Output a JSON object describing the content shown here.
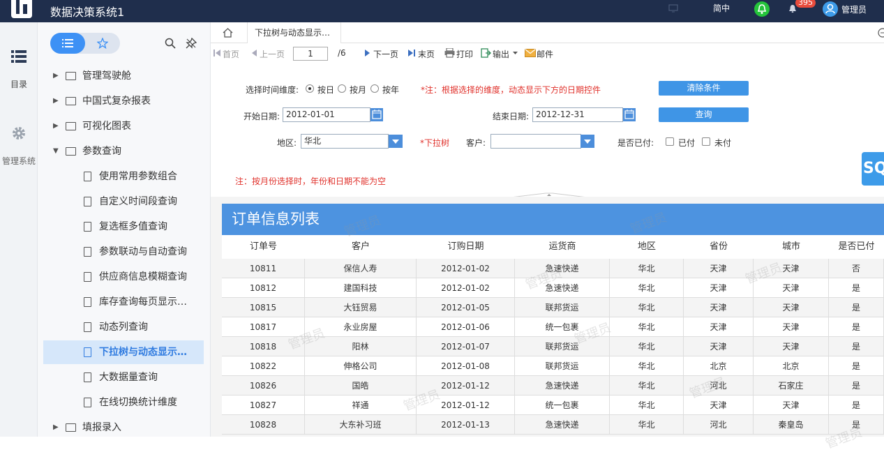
{
  "app": {
    "title": "数据决策系统1",
    "lang": "简中",
    "notif_count": "395",
    "user": "管理员"
  },
  "rail": {
    "catalog": "目录",
    "admin": "管理系统"
  },
  "tree": [
    {
      "label": "管理驾驶舱",
      "type": "folder"
    },
    {
      "label": "中国式复杂报表",
      "type": "folder"
    },
    {
      "label": "可视化图表",
      "type": "folder"
    },
    {
      "label": "参数查询",
      "type": "folder",
      "expanded": true
    },
    {
      "label": "使用常用参数组合",
      "type": "doc"
    },
    {
      "label": "自定义时间段查询",
      "type": "doc"
    },
    {
      "label": "复选框多值查询",
      "type": "doc"
    },
    {
      "label": "参数联动与自动查询",
      "type": "doc"
    },
    {
      "label": "供应商信息模糊查询",
      "type": "doc"
    },
    {
      "label": "库存查询每页显示…",
      "type": "doc"
    },
    {
      "label": "动态列查询",
      "type": "doc"
    },
    {
      "label": "下拉树与动态显示…",
      "type": "doc",
      "active": true
    },
    {
      "label": "大数据量查询",
      "type": "doc"
    },
    {
      "label": "在线切换统计维度",
      "type": "doc"
    },
    {
      "label": "填报录入",
      "type": "folder"
    }
  ],
  "tab": {
    "label": "下拉树与动态显示…"
  },
  "toolbar": {
    "first": "首页",
    "prev": "上一页",
    "page": "1",
    "total": "/6",
    "next": "下一页",
    "last": "末页",
    "print": "打印",
    "export": "输出",
    "mail": "邮件"
  },
  "form": {
    "dim_label": "选择时间维度:",
    "by_day": "按日",
    "by_month": "按月",
    "by_year": "按年",
    "note1": "*注：根据选择的维度，动态显示下方的日期控件",
    "clear_btn": "清除条件",
    "start_label": "开始日期:",
    "start_value": "2012-01-01",
    "end_label": "结束日期:",
    "end_value": "2012-12-31",
    "query_btn": "查询",
    "region_label": "地区:",
    "region_value": "华北",
    "tree_note": "*下拉树",
    "customer_label": "客户:",
    "customer_value": "",
    "paid_label": "是否已付:",
    "paid": "已付",
    "unpaid": "未付",
    "note2": "注：按月份选择时，年份和日期不能为空"
  },
  "sq_label": "SQ",
  "report": {
    "title": "订单信息列表",
    "watermark": "管理员",
    "columns": [
      "订单号",
      "客户",
      "订购日期",
      "运货商",
      "地区",
      "省份",
      "城市",
      "是否已付"
    ],
    "rows": [
      [
        "10811",
        "保信人寿",
        "2012-01-02",
        "急速快递",
        "华北",
        "天津",
        "天津",
        "否"
      ],
      [
        "10812",
        "建国科技",
        "2012-01-02",
        "急速快递",
        "华北",
        "天津",
        "天津",
        "是"
      ],
      [
        "10815",
        "大钰贸易",
        "2012-01-05",
        "联邦货运",
        "华北",
        "天津",
        "天津",
        "是"
      ],
      [
        "10817",
        "永业房屋",
        "2012-01-06",
        "统一包裹",
        "华北",
        "天津",
        "天津",
        "是"
      ],
      [
        "10818",
        "阳林",
        "2012-01-07",
        "联邦货运",
        "华北",
        "天津",
        "天津",
        "是"
      ],
      [
        "10822",
        "伸格公司",
        "2012-01-08",
        "联邦货运",
        "华北",
        "北京",
        "北京",
        "是"
      ],
      [
        "10826",
        "国皓",
        "2012-01-12",
        "急速快递",
        "华北",
        "河北",
        "石家庄",
        "是"
      ],
      [
        "10827",
        "祥通",
        "2012-01-12",
        "统一包裹",
        "华北",
        "天津",
        "天津",
        "是"
      ],
      [
        "10828",
        "大东补习班",
        "2012-01-13",
        "急速快递",
        "华北",
        "河北",
        "秦皇岛",
        "是"
      ]
    ]
  },
  "colors": {
    "topbar": "#1f2e4c",
    "accent": "#3d91f5",
    "header": "#4d93e0",
    "note": "#e0312b"
  }
}
